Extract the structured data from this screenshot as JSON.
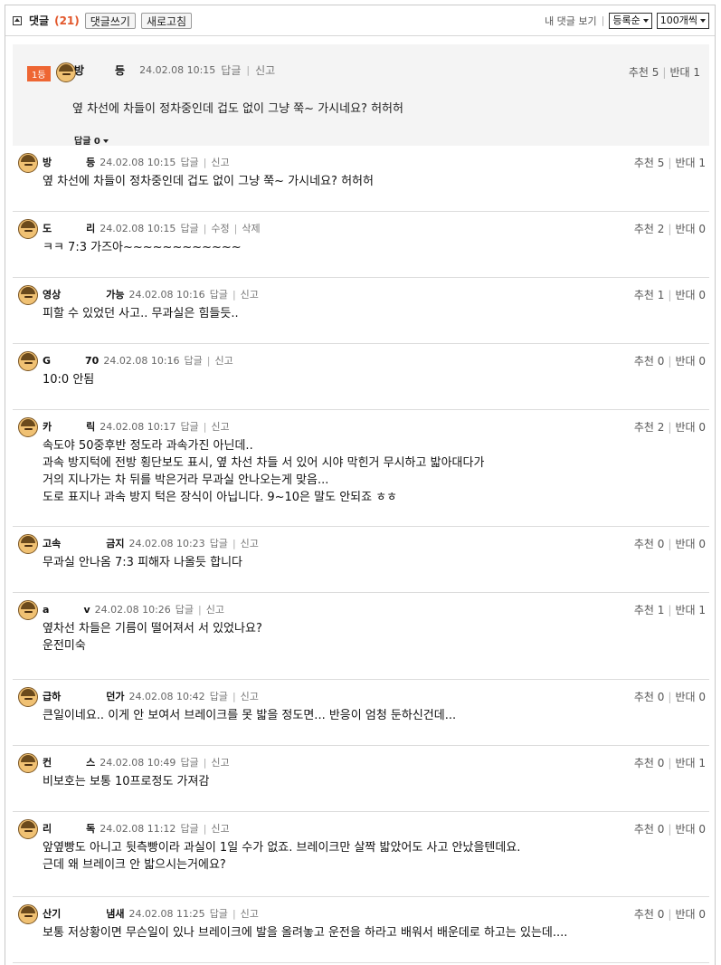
{
  "header": {
    "title": "댓글",
    "count": "(21)",
    "write_btn": "댓글쓰기",
    "refresh_btn": "새로고침",
    "my_comments": "내 댓글 보기",
    "sort_value": "등록순",
    "page_size_value": "100개씩"
  },
  "best": {
    "rank": "1등",
    "nick_a": "방",
    "nick_b": "등",
    "date": "24.02.08 10:15",
    "reply": "답글",
    "report": "신고",
    "text": "옆 차선에 차들이 정차중인데 겁도 없이 그냥 쭉~ 가시네요? 허허허",
    "reply_count": "답글 0",
    "up": "추천 5",
    "down": "반대 1"
  },
  "comments": [
    {
      "nick_a": "방",
      "nick_b": "등",
      "date": "24.02.08 10:15",
      "act1": "답글",
      "act2": "신고",
      "lines": [
        "옆 차선에 차들이 정차중인데 겁도 없이 그냥 쭉~ 가시네요? 허허허"
      ],
      "up": "추천 5",
      "down": "반대 1"
    },
    {
      "nick_a": "도",
      "nick_b": "리",
      "date": "24.02.08 10:15",
      "act1": "답글",
      "act2": "수정",
      "act3": "삭제",
      "lines": [
        "ㅋㅋ 7:3 가즈아~~~~~~~~~~~~"
      ],
      "up": "추천 2",
      "down": "반대 0"
    },
    {
      "nick_a": "영상",
      "nick_b": "가능",
      "date": "24.02.08 10:16",
      "act1": "답글",
      "act2": "신고",
      "lines": [
        "피할 수 있었던 사고.. 무과실은 힘들듯.."
      ],
      "up": "추천 1",
      "down": "반대 0"
    },
    {
      "nick_a": "G",
      "nick_b": "70",
      "date": "24.02.08 10:16",
      "act1": "답글",
      "act2": "신고",
      "lines": [
        "10:0 안됨"
      ],
      "up": "추천 0",
      "down": "반대 0"
    },
    {
      "nick_a": "카",
      "nick_b": "릭",
      "date": "24.02.08 10:17",
      "act1": "답글",
      "act2": "신고",
      "lines": [
        "속도야 50중후반 정도라 과속가진 아닌데..",
        "과속 방지턱에 전방 횡단보도 표시, 옆 차선 차들 서 있어 시야 막힌거 무시하고 밟아대다가",
        "거의 지나가는 차 뒤를 박은거라 무과실 안나오는게 맞음...",
        "도로 표지나 과속 방지 턱은 장식이 아닙니다. 9~10은 말도 안되죠 ㅎㅎ"
      ],
      "up": "추천 2",
      "down": "반대 0"
    },
    {
      "nick_a": "고속",
      "nick_b": "금지",
      "date": "24.02.08 10:23",
      "act1": "답글",
      "act2": "신고",
      "lines": [
        "무과실 안나옴 7:3 피해자 나올듯 합니다"
      ],
      "up": "추천 0",
      "down": "반대 0"
    },
    {
      "nick_a": "a",
      "nick_b": "v",
      "date": "24.02.08 10:26",
      "act1": "답글",
      "act2": "신고",
      "lines": [
        "옆차선 차들은 기름이 떨어져서 서 있었나요?",
        "운전미숙"
      ],
      "up": "추천 1",
      "down": "반대 1"
    },
    {
      "nick_a": "급하",
      "nick_b": "던가",
      "date": "24.02.08 10:42",
      "act1": "답글",
      "act2": "신고",
      "lines": [
        "큰일이네요.. 이게 안 보여서 브레이크를 못 밟을 정도면... 반응이 엄청 둔하신건데..."
      ],
      "up": "추천 0",
      "down": "반대 0"
    },
    {
      "nick_a": "컨",
      "nick_b": "스",
      "date": "24.02.08 10:49",
      "act1": "답글",
      "act2": "신고",
      "lines": [
        "비보호는 보통 10프로정도 가져감"
      ],
      "up": "추천 0",
      "down": "반대 1"
    },
    {
      "nick_a": "리",
      "nick_b": "독",
      "date": "24.02.08 11:12",
      "act1": "답글",
      "act2": "신고",
      "lines": [
        "앞옆빵도 아니고 뒷측빵이라 과실이 1일 수가 없죠. 브레이크만 살짝 밟았어도 사고 안났을텐데요.",
        "근데 왜 브레이크 안 밟으시는거에요?"
      ],
      "up": "추천 0",
      "down": "반대 0"
    },
    {
      "nick_a": "산기",
      "nick_b": "냄새",
      "date": "24.02.08 11:25",
      "act1": "답글",
      "act2": "신고",
      "lines": [
        "보통 저상황이면 무슨일이 있나 브레이크에 발을 올려놓고 운전을 하라고 배워서 배운데로 하고는 있는데...."
      ],
      "up": "추천 0",
      "down": "반대 0"
    }
  ]
}
